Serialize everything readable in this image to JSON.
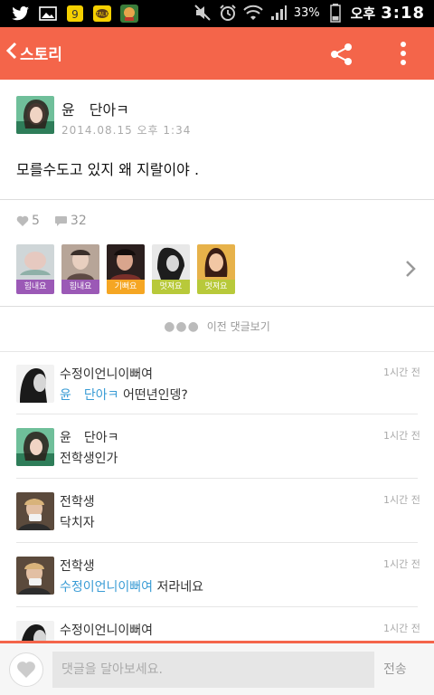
{
  "status_bar": {
    "battery_percent": "33%",
    "ampm": "오후",
    "time": "3:18",
    "left_icons": [
      "twitter-icon",
      "gallery-icon",
      "kakaopage-icon",
      "kakaotalk-icon",
      "game-icon"
    ],
    "right_icons": [
      "mute-icon",
      "alarm-icon",
      "wifi-icon",
      "signal-icon",
      "battery-icon"
    ]
  },
  "header": {
    "back_label": "스토리",
    "accent": "#f4654a"
  },
  "post": {
    "author": "윤　단아ㅋ",
    "date": "2014.08.15 오후 1:34",
    "body": "모를수도고 있지 왜 지랄이야 ."
  },
  "stats": {
    "likes": "5",
    "comments": "32"
  },
  "reactions": [
    {
      "label": "힘내요",
      "color": "#9b59b6"
    },
    {
      "label": "힘내요",
      "color": "#9b59b6"
    },
    {
      "label": "기뻐요",
      "color": "#f5a623"
    },
    {
      "label": "멋져요",
      "color": "#b8c93a"
    },
    {
      "label": "멋져요",
      "color": "#b8c93a"
    }
  ],
  "prev_comments": "이전 댓글보기",
  "comments": [
    {
      "author": "수정이언니이뻐여",
      "time": "1시간 전",
      "mention": "윤　단아ㅋ",
      "text": " 어떤년인뎅?"
    },
    {
      "author": "윤　단아ㅋ",
      "time": "1시간 전",
      "mention": "",
      "text": "전학생인가"
    },
    {
      "author": "전학생",
      "time": "1시간 전",
      "mention": "",
      "text": "닥치자"
    },
    {
      "author": "전학생",
      "time": "1시간 전",
      "mention": "수정이언니이뻐여",
      "text": " 저라네요"
    },
    {
      "author": "수정이언니이뻐여",
      "time": "1시간 전",
      "mention": "",
      "text": ""
    }
  ],
  "input": {
    "placeholder": "댓글을 달아보세요.",
    "send_label": "전송"
  }
}
